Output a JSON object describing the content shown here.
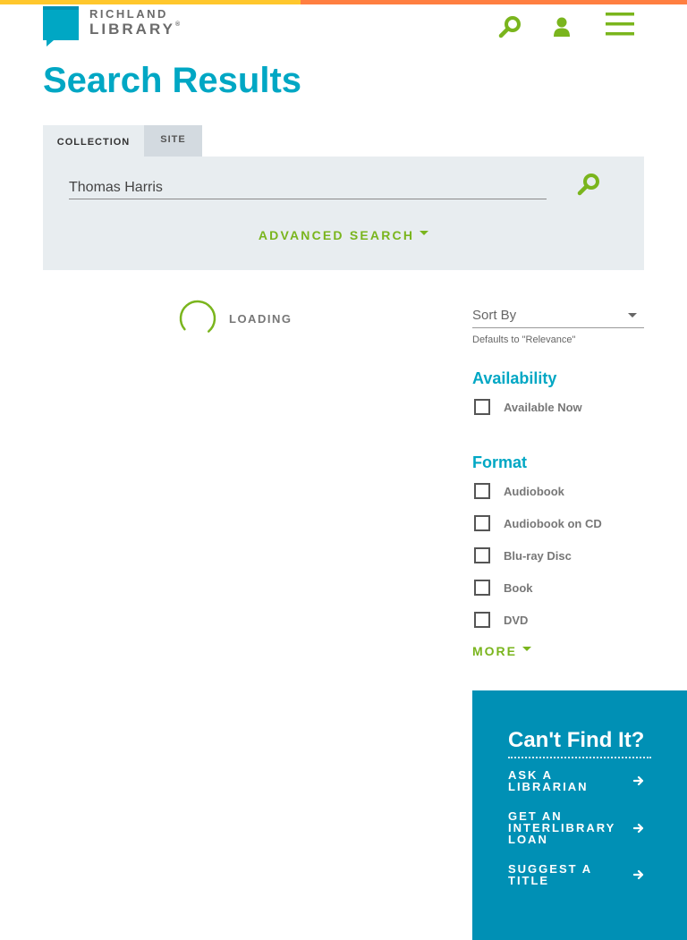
{
  "colors": {
    "brand_blue": "#00a7c4",
    "accent_green": "#7ab51d",
    "bar_yellow": "#ffc72c",
    "bar_orange": "#ff7f41",
    "panel_gray": "#e8edf0",
    "cta_blue": "#0090b5"
  },
  "header": {
    "logo_line1": "RICHLAND",
    "logo_line2": "LIBRARY",
    "logo_reg": "®",
    "icons": [
      "search-icon",
      "user-icon",
      "menu-icon"
    ]
  },
  "page": {
    "title": "Search Results"
  },
  "search": {
    "tabs": [
      {
        "label": "COLLECTION",
        "active": true
      },
      {
        "label": "SITE",
        "active": false
      }
    ],
    "query": "Thomas Harris",
    "advanced_label": "ADVANCED SEARCH"
  },
  "results": {
    "loading_label": "LOADING"
  },
  "sort": {
    "label": "Sort By",
    "hint": "Defaults to \"Relevance\""
  },
  "facets": {
    "availability": {
      "title": "Availability",
      "options": [
        "Available Now"
      ]
    },
    "format": {
      "title": "Format",
      "options": [
        "Audiobook",
        "Audiobook on CD",
        "Blu-ray Disc",
        "Book",
        "DVD"
      ],
      "more_label": "MORE"
    }
  },
  "cant_find": {
    "title": "Can't Find It?",
    "links": [
      {
        "label": "ASK A LIBRARIAN"
      },
      {
        "label": "GET AN INTERLIBRARY LOAN"
      },
      {
        "label": "SUGGEST A TITLE"
      }
    ]
  }
}
